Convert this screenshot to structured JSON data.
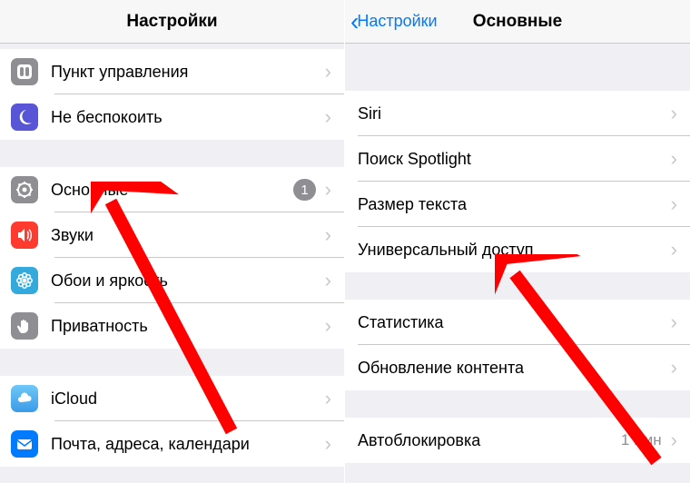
{
  "left": {
    "title": "Настройки",
    "group1": [
      {
        "label": "Пункт управления",
        "icon": "control-center",
        "bg": "bg-gray"
      },
      {
        "label": "Не беспокоить",
        "icon": "moon",
        "bg": "bg-purple"
      }
    ],
    "group2": [
      {
        "label": "Основные",
        "icon": "gear",
        "bg": "bg-gray",
        "badge": "1"
      },
      {
        "label": "Звуки",
        "icon": "speaker",
        "bg": "bg-red"
      },
      {
        "label": "Обои и яркость",
        "icon": "flower",
        "bg": "bg-teal"
      },
      {
        "label": "Приватность",
        "icon": "hand",
        "bg": "bg-gray"
      }
    ],
    "group3": [
      {
        "label": "iCloud",
        "icon": "cloud",
        "bg": "bg-teal"
      },
      {
        "label": "Почта, адреса, календари",
        "icon": "mail",
        "bg": "bg-blue"
      }
    ]
  },
  "right": {
    "back": "Настройки",
    "title": "Основные",
    "group1": [
      {
        "label": "Siri"
      },
      {
        "label": "Поиск Spotlight"
      },
      {
        "label": "Размер текста"
      },
      {
        "label": "Универсальный доступ"
      }
    ],
    "group2": [
      {
        "label": "Статистика"
      },
      {
        "label": "Обновление контента"
      }
    ],
    "group3": [
      {
        "label": "Автоблокировка",
        "value": "1 мин"
      }
    ]
  }
}
